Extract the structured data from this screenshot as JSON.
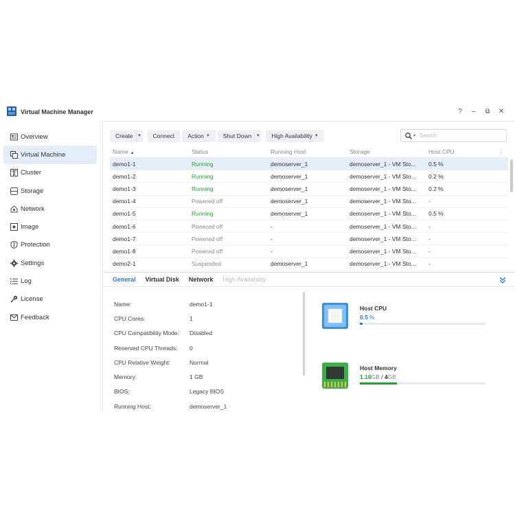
{
  "app": {
    "title": "Virtual Machine Manager"
  },
  "window_controls": {
    "help": "?",
    "minimize": "–",
    "restore": "⧉",
    "close": "✕"
  },
  "sidebar": {
    "items": [
      {
        "label": "Overview",
        "icon": "overview-icon",
        "active": false
      },
      {
        "label": "Virtual Machine",
        "icon": "virtual-machine-icon",
        "active": true
      },
      {
        "label": "Cluster",
        "icon": "cluster-icon",
        "active": false
      },
      {
        "label": "Storage",
        "icon": "storage-icon",
        "active": false
      },
      {
        "label": "Network",
        "icon": "network-icon",
        "active": false
      },
      {
        "label": "Image",
        "icon": "image-icon",
        "active": false
      },
      {
        "label": "Protection",
        "icon": "protection-icon",
        "active": false
      },
      {
        "label": "Settings",
        "icon": "settings-icon",
        "active": false
      },
      {
        "label": "Log",
        "icon": "log-icon",
        "active": false
      },
      {
        "label": "License",
        "icon": "license-icon",
        "active": false
      },
      {
        "label": "Feedback",
        "icon": "feedback-icon",
        "active": false
      }
    ]
  },
  "toolbar": {
    "create": "Create",
    "connect": "Connect",
    "action": "Action",
    "shutdown": "Shut Down",
    "high_availability": "High Availability"
  },
  "search": {
    "placeholder": "Search"
  },
  "table": {
    "headers": {
      "name": "Name",
      "status": "Status",
      "host": "Running Host",
      "storage": "Storage",
      "cpu": "Host CPU"
    },
    "rows": [
      {
        "name": "demo1-1",
        "status": "Running",
        "status_type": "running",
        "host": "demoserver_1",
        "storage": "demoserver_1 - VM Sto...",
        "cpu": "0.5 %",
        "selected": true
      },
      {
        "name": "demo1-2",
        "status": "Running",
        "status_type": "running",
        "host": "demoserver_1",
        "storage": "demoserver_1 - VM Sto...",
        "cpu": "0.2 %",
        "selected": false
      },
      {
        "name": "demo1-3",
        "status": "Running",
        "status_type": "running",
        "host": "demoserver_1",
        "storage": "demoserver_1 - VM Sto...",
        "cpu": "0.2 %",
        "selected": false
      },
      {
        "name": "demo1-4",
        "status": "Powered off",
        "status_type": "off",
        "host": "demoserver_1",
        "storage": "demoserver_1 - VM Sto...",
        "cpu": "-",
        "selected": false
      },
      {
        "name": "demo1-5",
        "status": "Running",
        "status_type": "running",
        "host": "demoserver_1",
        "storage": "demoserver_1 - VM Sto...",
        "cpu": "0.5 %",
        "selected": false
      },
      {
        "name": "demo1-6",
        "status": "Powered off",
        "status_type": "off",
        "host": "-",
        "storage": "demoserver_1 - VM Sto...",
        "cpu": "-",
        "selected": false
      },
      {
        "name": "demo1-7",
        "status": "Powered off",
        "status_type": "off",
        "host": "-",
        "storage": "demoserver_1 - VM Sto...",
        "cpu": "-",
        "selected": false
      },
      {
        "name": "demo1-8",
        "status": "Powered off",
        "status_type": "off",
        "host": "-",
        "storage": "demoserver_1 - VM Sto...",
        "cpu": "-",
        "selected": false
      },
      {
        "name": "demo2-1",
        "status": "Suspended",
        "status_type": "suspended",
        "host": "demoserver_1",
        "storage": "demoserver_1 - VM Sto...",
        "cpu": "-",
        "selected": false
      }
    ]
  },
  "detail_tabs": [
    {
      "label": "General",
      "state": "active"
    },
    {
      "label": "Virtual Disk",
      "state": "normal"
    },
    {
      "label": "Network",
      "state": "normal"
    },
    {
      "label": "High Availability",
      "state": "disabled"
    }
  ],
  "properties": [
    {
      "label": "Name:",
      "value": "demo1-1"
    },
    {
      "label": "CPU Cores:",
      "value": "1"
    },
    {
      "label": "CPU Compatibility Mode:",
      "value": "Disabled"
    },
    {
      "label": "Reserved CPU Threads:",
      "value": "0"
    },
    {
      "label": "CPU Relative Weight:",
      "value": "Normal"
    },
    {
      "label": "Memory:",
      "value": "1 GB"
    },
    {
      "label": "BIOS:",
      "value": "Legacy BIOS"
    },
    {
      "label": "Running Host:",
      "value": "demoserver_1"
    }
  ],
  "host_cpu": {
    "title": "Host CPU",
    "value": "0.5",
    "unit": "%",
    "fraction": 0.02,
    "color": "#2a7bd3"
  },
  "host_memory": {
    "title": "Host Memory",
    "used": "1.18",
    "used_unit": "GB",
    "separator": "/",
    "total": "4",
    "total_unit": "GB",
    "fraction": 0.295,
    "color": "#1f9d2e"
  },
  "colors": {
    "accent": "#2a7bd3",
    "running": "#2e9a37",
    "selected_row": "#e4eef9"
  }
}
